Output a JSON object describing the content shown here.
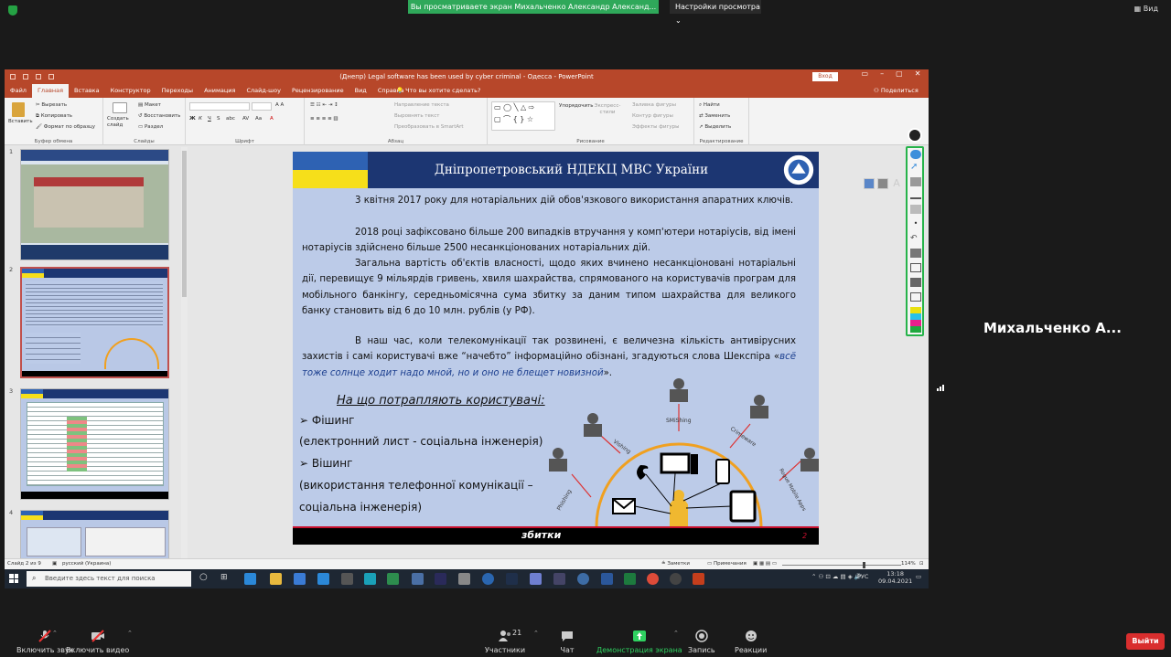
{
  "zoom": {
    "share_banner": "Вы просматриваете экран Михальченко Александр Александ...",
    "view_options": "Настройки просмотра",
    "view_button": "Вид",
    "participant_name": "Михальченко А...",
    "participants_count": "21",
    "bottom": {
      "mute": "Включить звук",
      "video": "Включить видео",
      "participants": "Участники",
      "chat": "Чат",
      "share": "Демонстрация экрана",
      "record": "Запись",
      "reactions": "Реакции",
      "end": "Выйти"
    },
    "colors": {
      "green": "#2fa85a",
      "end_red": "#d92e2e"
    }
  },
  "ppt": {
    "title": "(Днепр) Legal software has been used by cyber criminal - Одесса  -  PowerPoint",
    "signin": "Вход",
    "tabs": [
      "Файл",
      "Главная",
      "Вставка",
      "Конструктор",
      "Переходы",
      "Анимация",
      "Слайд-шоу",
      "Рецензирование",
      "Вид",
      "Справка"
    ],
    "tellme": "Что вы хотите сделать?",
    "share": "Поделиться",
    "ribbon": {
      "paste": "Вставить",
      "cut": "Вырезать",
      "copy": "Копировать",
      "format_painter": "Формат по образцу",
      "clipboard": "Буфер обмена",
      "new_slide": "Создать слайд",
      "layout": "Макет",
      "reset": "Восстановить",
      "section": "Раздел",
      "slides": "Слайды",
      "font": "Шрифт",
      "paragraph": "Абзац",
      "text_direction": "Направление текста",
      "align_text": "Выровнять текст",
      "smartart": "Преобразовать в SmartArt",
      "arrange": "Упорядочить",
      "quick_styles": "Экспресс-стили",
      "shape_fill": "Заливка фигуры",
      "shape_outline": "Контур фигуры",
      "shape_effects": "Эффекты фигуры",
      "drawing": "Рисование",
      "find": "Найти",
      "replace": "Заменить",
      "select": "Выделить",
      "editing": "Редактирование"
    },
    "status": {
      "slide": "Слайд 2 из 9",
      "language": "русский (Украина)",
      "notes": "Заметки",
      "comments": "Примечания",
      "zoom": "114%"
    },
    "thumb_numbers": [
      "1",
      "2",
      "3",
      "4"
    ]
  },
  "slide": {
    "title": "Дніпропетровський НДЕКЦ МВС України",
    "paragraphs": [
      "3 квітня 2017 року для нотаріальних дій обов'язкового використання апаратних ключів.",
      "2018 році зафіксовано більше 200 випадків втручання у комп'ютери нотаріусів, від імені нотаріусів здійснено більше 2500 несанкціонованих нотаріальних дій.",
      "Загальна вартість об'єктів власності, щодо яких вчинено несанкціоновані нотаріальні дії, перевищує 9 мільярдів гривень, хвиля шахрайства, спрямованого на користувачів програм для мобільного банкінгу, середньомісячна сума збитку за даним типом шахрайства для великого банку становить від 6 до 10 млн. рублів (у РФ)."
    ],
    "p4_before": "В наш час, коли телекомунікації так розвинені, є величезна кількість антивірусних захистів і самі користувачі вже “начебто” інформаційно обізнані, згадуються слова Шекспіра «",
    "p4_quote": "всё тоже солнце ходит надо мной, но и оно не блещет новизной",
    "p4_after": "».",
    "heading": "На що потрапляють користувачі:",
    "bullets": {
      "b1": "Фішинг",
      "b1_sub": "(електронний лист - соціальна інженерія)",
      "b2": "Вішинг",
      "b2_sub1": "(використання телефонної комунікації –",
      "b2_sub2": "соціальна інженерія)"
    },
    "diagram_labels": [
      "Phishing",
      "Vishing",
      "SMiShing",
      "Crimeware",
      "Rogue Mobile Apps"
    ],
    "footer": "збитки",
    "page": "2"
  },
  "taskbar": {
    "search": "Введите здесь текст для поиска",
    "lang": "РУС",
    "time": "13:18",
    "date": "09.04.2021"
  }
}
